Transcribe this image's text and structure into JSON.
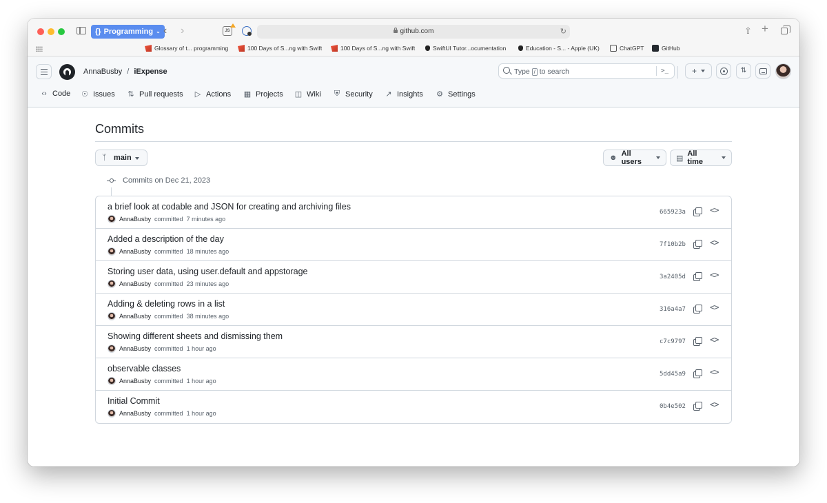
{
  "browser": {
    "tab_group": "Programming",
    "tab_group_icon": "curly-braces",
    "url": "github.com",
    "extension_badge": "JS",
    "favorites": [
      {
        "label": "Glossary of t... programming",
        "icon": "swift-icon"
      },
      {
        "label": "100 Days of S...ng with Swift",
        "icon": "swift-icon"
      },
      {
        "label": "100 Days of S...ng with Swift",
        "icon": "swift-icon"
      },
      {
        "label": "SwiftUI Tutor...ocumentation",
        "icon": "apple-icon"
      },
      {
        "label": "Education - S... - Apple (UK)",
        "icon": "apple-icon"
      },
      {
        "label": "ChatGPT",
        "icon": "chatgpt-icon"
      },
      {
        "label": "GitHub",
        "icon": "github-icon"
      }
    ]
  },
  "header": {
    "owner": "AnnaBusby",
    "separator": "/",
    "repo": "iExpense",
    "search_prefix": "Type",
    "search_key": "/",
    "search_suffix": "to search",
    "new_button": "+"
  },
  "repo_nav": [
    {
      "label": "Code",
      "icon": "code-icon"
    },
    {
      "label": "Issues",
      "icon": "issue-icon"
    },
    {
      "label": "Pull requests",
      "icon": "pull-request-icon"
    },
    {
      "label": "Actions",
      "icon": "play-icon"
    },
    {
      "label": "Projects",
      "icon": "table-icon"
    },
    {
      "label": "Wiki",
      "icon": "book-icon"
    },
    {
      "label": "Security",
      "icon": "shield-icon"
    },
    {
      "label": "Insights",
      "icon": "graph-icon"
    },
    {
      "label": "Settings",
      "icon": "gear-icon"
    }
  ],
  "page": {
    "title": "Commits",
    "branch": "main",
    "users_filter": "All users",
    "time_filter": "All time",
    "date_heading": "Commits on Dec 21, 2023"
  },
  "commits": [
    {
      "message": "a brief look at codable and JSON for creating and archiving files",
      "author": "AnnaBusby",
      "verb": "committed",
      "time": "7 minutes ago",
      "sha": "665923a"
    },
    {
      "message": "Added a description of the day",
      "author": "AnnaBusby",
      "verb": "committed",
      "time": "18 minutes ago",
      "sha": "7f10b2b"
    },
    {
      "message": "Storing user data, using user.default and appstorage",
      "author": "AnnaBusby",
      "verb": "committed",
      "time": "23 minutes ago",
      "sha": "3a2405d"
    },
    {
      "message": "Adding & deleting rows in a list",
      "author": "AnnaBusby",
      "verb": "committed",
      "time": "38 minutes ago",
      "sha": "316a4a7"
    },
    {
      "message": "Showing different sheets and dismissing them",
      "author": "AnnaBusby",
      "verb": "committed",
      "time": "1 hour ago",
      "sha": "c7c9797"
    },
    {
      "message": "observable classes",
      "author": "AnnaBusby",
      "verb": "committed",
      "time": "1 hour ago",
      "sha": "5dd45a9"
    },
    {
      "message": "Initial Commit",
      "author": "AnnaBusby",
      "verb": "committed",
      "time": "1 hour ago",
      "sha": "0b4e502"
    }
  ],
  "colors": {
    "accent": "#0969da",
    "tab_group": "#5b8def",
    "border": "#d0d7de",
    "muted_text": "#57606a"
  }
}
